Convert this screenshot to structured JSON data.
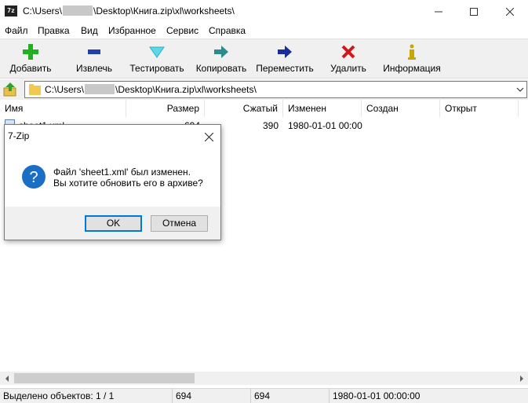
{
  "window": {
    "title_prefix": "C:\\Users\\",
    "title_suffix": "\\Desktop\\Книга.zip\\xl\\worksheets\\",
    "app_icon_text": "7z",
    "controls": {
      "minimize": "minimize-icon",
      "maximize": "maximize-icon",
      "close": "close-icon"
    }
  },
  "menu": {
    "items": [
      "Файл",
      "Правка",
      "Вид",
      "Избранное",
      "Сервис",
      "Справка"
    ]
  },
  "toolbar": {
    "items": [
      {
        "label": "Добавить",
        "icon": "add-plus-icon",
        "color": "#22b022"
      },
      {
        "label": "Извлечь",
        "icon": "extract-minus-icon",
        "color": "#1f3fb0"
      },
      {
        "label": "Тестировать",
        "icon": "test-check-icon",
        "color": "#21b5c8"
      },
      {
        "label": "Копировать",
        "icon": "copy-arrow-icon",
        "color": "#2a8c8c"
      },
      {
        "label": "Переместить",
        "icon": "move-arrow-icon",
        "color": "#1a2c9c"
      },
      {
        "label": "Удалить",
        "icon": "delete-x-icon",
        "color": "#d01818"
      },
      {
        "label": "Информация",
        "icon": "info-icon",
        "color": "#c8a800"
      }
    ]
  },
  "address": {
    "path_prefix": "C:\\Users\\",
    "path_suffix": "\\Desktop\\Книга.zip\\xl\\worksheets\\"
  },
  "filelist": {
    "columns": [
      "Имя",
      "Размер",
      "Сжатый",
      "Изменен",
      "Создан",
      "Открыт"
    ],
    "rows": [
      {
        "name": "sheet1.xml",
        "size": "694",
        "packed": "390",
        "modified": "1980-01-01 00:00",
        "created": "",
        "accessed": ""
      }
    ]
  },
  "status": {
    "selected": "Выделено объектов: 1 / 1",
    "size": "694",
    "packed": "694",
    "modified": "1980-01-01 00:00:00"
  },
  "dialog": {
    "title": "7-Zip",
    "message_line1": "Файл 'sheet1.xml' был изменен.",
    "message_line2": "Вы хотите обновить его в архиве?",
    "ok_label": "OK",
    "cancel_label": "Отмена"
  }
}
